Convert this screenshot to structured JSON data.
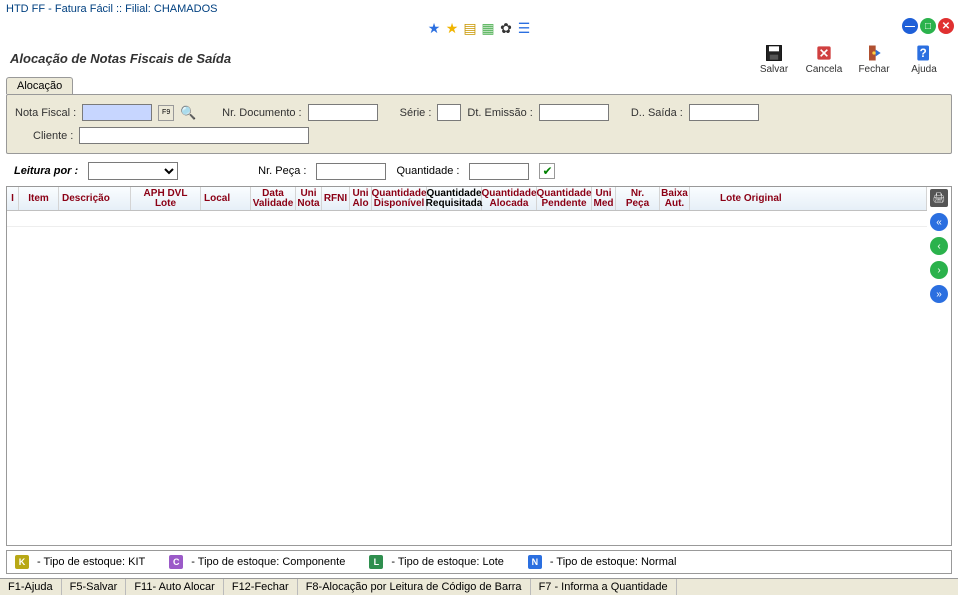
{
  "app": {
    "title": "HTD FF - Fatura Fácil  ::  Filial: CHAMADOS"
  },
  "toolbar_center": {},
  "page": {
    "title": "Alocação de Notas Fiscais de Saída"
  },
  "actions": {
    "save": "Salvar",
    "cancel": "Cancela",
    "close": "Fechar",
    "help": "Ajuda"
  },
  "tabs": {
    "alocacao": "Alocação"
  },
  "form": {
    "nota_fiscal_label": "Nota Fiscal :",
    "nota_fiscal_value": "",
    "lookup_text": "F9",
    "nr_documento_label": "Nr. Documento :",
    "nr_documento_value": "",
    "serie_label": "Série :",
    "serie_value": "",
    "dt_emissao_label": "Dt. Emissão :",
    "dt_emissao_value": "",
    "dt_saida_label": "D.. Saída :",
    "dt_saida_value": "",
    "cliente_label": "Cliente :",
    "cliente_value": ""
  },
  "filter": {
    "leitura_por_label": "Leitura por :",
    "leitura_por_value": "",
    "nr_peca_label": "Nr. Peça :",
    "nr_peca_value": "",
    "quantidade_label": "Quantidade :",
    "quantidade_value": ""
  },
  "grid": {
    "columns": [
      "I",
      "Item",
      "Descrição",
      "APH DVL Lote",
      "Local",
      "Data Validade",
      "Uni Nota",
      "RFNI",
      "Uni Alo",
      "Quantidade Disponível",
      "Quantidade Requisitada",
      "Quantidade Alocada",
      "Quantidade Pendente",
      "Uni Med",
      "Nr. Peça",
      "Baixa Aut.",
      "Lote Original"
    ],
    "rows": []
  },
  "legend": {
    "kit": "- Tipo de estoque: KIT",
    "componente": "- Tipo de estoque: Componente",
    "lote": "- Tipo de estoque: Lote",
    "normal": "- Tipo de estoque: Normal"
  },
  "status": {
    "f1": "F1-Ajuda",
    "f5": "F5-Salvar",
    "f11": "F11- Auto Alocar",
    "f12": "F12-Fechar",
    "f8": "F8-Alocação por Leitura de Código de Barra",
    "f7": "F7 - Informa a Quantidade"
  }
}
